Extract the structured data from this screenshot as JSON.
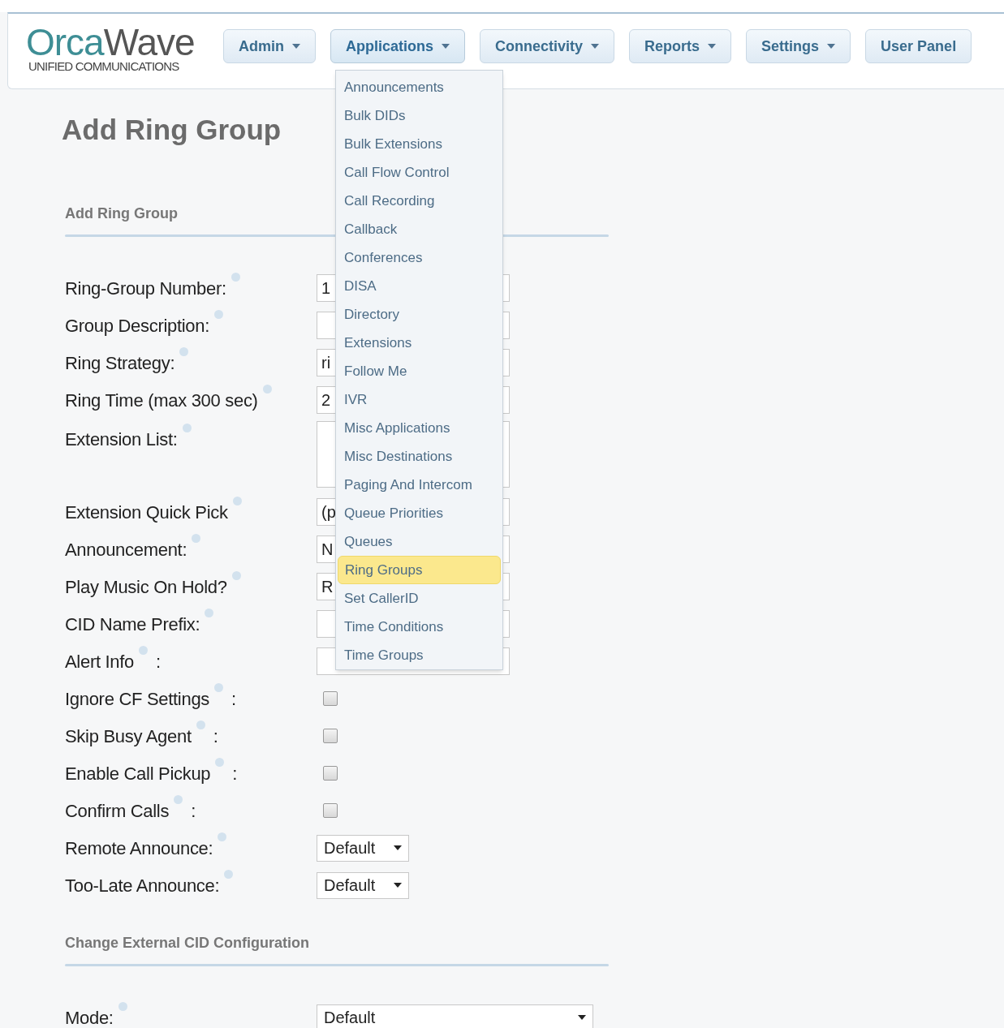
{
  "logo": {
    "primary": "Orca",
    "secondary": "Wave",
    "tagline": "UNIFIED COMMUNICATIONS"
  },
  "nav": [
    {
      "label": "Admin",
      "has_menu": true,
      "expanded": false
    },
    {
      "label": "Applications",
      "has_menu": true,
      "expanded": true
    },
    {
      "label": "Connectivity",
      "has_menu": true,
      "expanded": false
    },
    {
      "label": "Reports",
      "has_menu": true,
      "expanded": false
    },
    {
      "label": "Settings",
      "has_menu": true,
      "expanded": false
    },
    {
      "label": "User Panel",
      "has_menu": false,
      "expanded": false
    }
  ],
  "menu": [
    {
      "label": "Announcements",
      "selected": false
    },
    {
      "label": "Bulk DIDs",
      "selected": false
    },
    {
      "label": "Bulk Extensions",
      "selected": false
    },
    {
      "label": "Call Flow Control",
      "selected": false
    },
    {
      "label": "Call Recording",
      "selected": false
    },
    {
      "label": "Callback",
      "selected": false
    },
    {
      "label": "Conferences",
      "selected": false
    },
    {
      "label": "DISA",
      "selected": false
    },
    {
      "label": "Directory",
      "selected": false
    },
    {
      "label": "Extensions",
      "selected": false
    },
    {
      "label": "Follow Me",
      "selected": false
    },
    {
      "label": "IVR",
      "selected": false
    },
    {
      "label": "Misc Applications",
      "selected": false
    },
    {
      "label": "Misc Destinations",
      "selected": false
    },
    {
      "label": "Paging And Intercom",
      "selected": false
    },
    {
      "label": "Queue Priorities",
      "selected": false
    },
    {
      "label": "Queues",
      "selected": false
    },
    {
      "label": "Ring Groups",
      "selected": true
    },
    {
      "label": "Set CallerID",
      "selected": false
    },
    {
      "label": "Time Conditions",
      "selected": false
    },
    {
      "label": "Time Groups",
      "selected": false
    }
  ],
  "page_title": "Add Ring Group",
  "sections": [
    {
      "title": "Add Ring Group",
      "rows": [
        {
          "label": "Ring-Group Number:",
          "kind": "text",
          "value": "1"
        },
        {
          "label": "Group Description:",
          "kind": "text"
        },
        {
          "label": "Ring Strategy:",
          "kind": "text",
          "value": "ri"
        },
        {
          "label": "Ring Time (max 300 sec)",
          "kind": "text",
          "value": "2"
        },
        {
          "label": "Extension List:",
          "kind": "textarea"
        },
        {
          "label": "Extension Quick Pick",
          "kind": "text",
          "value": "(p"
        },
        {
          "label": "Announcement:",
          "kind": "text",
          "value": "N"
        },
        {
          "label": "Play Music On Hold?",
          "kind": "text",
          "value": "R"
        },
        {
          "label": "CID Name Prefix:",
          "kind": "text"
        },
        {
          "label": "Alert Info",
          "suffix": ":",
          "kind": "text"
        },
        {
          "label": "Ignore CF Settings",
          "suffix": ":",
          "kind": "checkbox",
          "checked": false
        },
        {
          "label": "Skip Busy Agent",
          "suffix": ":",
          "kind": "checkbox",
          "checked": false
        },
        {
          "label": "Enable Call Pickup",
          "suffix": ":",
          "kind": "checkbox",
          "checked": false
        },
        {
          "label": "Confirm Calls",
          "suffix": ":",
          "kind": "checkbox",
          "checked": false
        },
        {
          "label": "Remote Announce:",
          "kind": "select",
          "value": "Default"
        },
        {
          "label": "Too-Late Announce:",
          "kind": "select",
          "value": "Default"
        }
      ]
    },
    {
      "title": "Change External CID Configuration",
      "rows": [
        {
          "label": "Mode:",
          "kind": "wideselect",
          "value": "Default"
        }
      ]
    }
  ]
}
